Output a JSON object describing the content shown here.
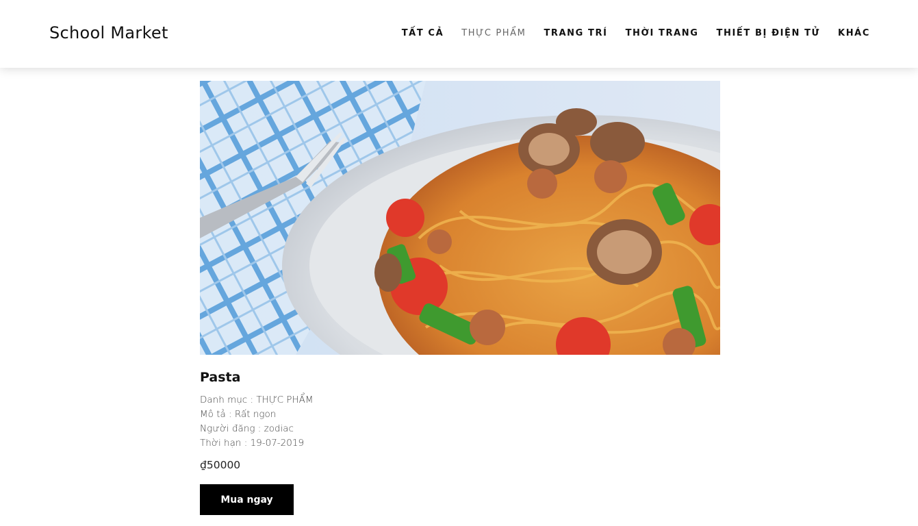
{
  "header": {
    "brand": "School Market",
    "nav": [
      {
        "label": "TẤT CẢ",
        "active": false
      },
      {
        "label": "THỰC PHẨM",
        "active": true
      },
      {
        "label": "TRANG TRÍ",
        "active": false
      },
      {
        "label": "THỜI TRANG",
        "active": false
      },
      {
        "label": "THIẾT BỊ ĐIỆN TỬ",
        "active": false
      },
      {
        "label": "KHÁC",
        "active": false
      }
    ]
  },
  "product": {
    "image_icon": "pasta-dish-photo",
    "title": "Pasta",
    "category": "Danh mục : THỰC PHẨM",
    "description": "Mô tả : Rất ngon",
    "poster": "Người đăng : zodiac",
    "deadline": "Thời hạn : 19-07-2019",
    "price": "₫50000",
    "buy_label": "Mua ngay"
  }
}
